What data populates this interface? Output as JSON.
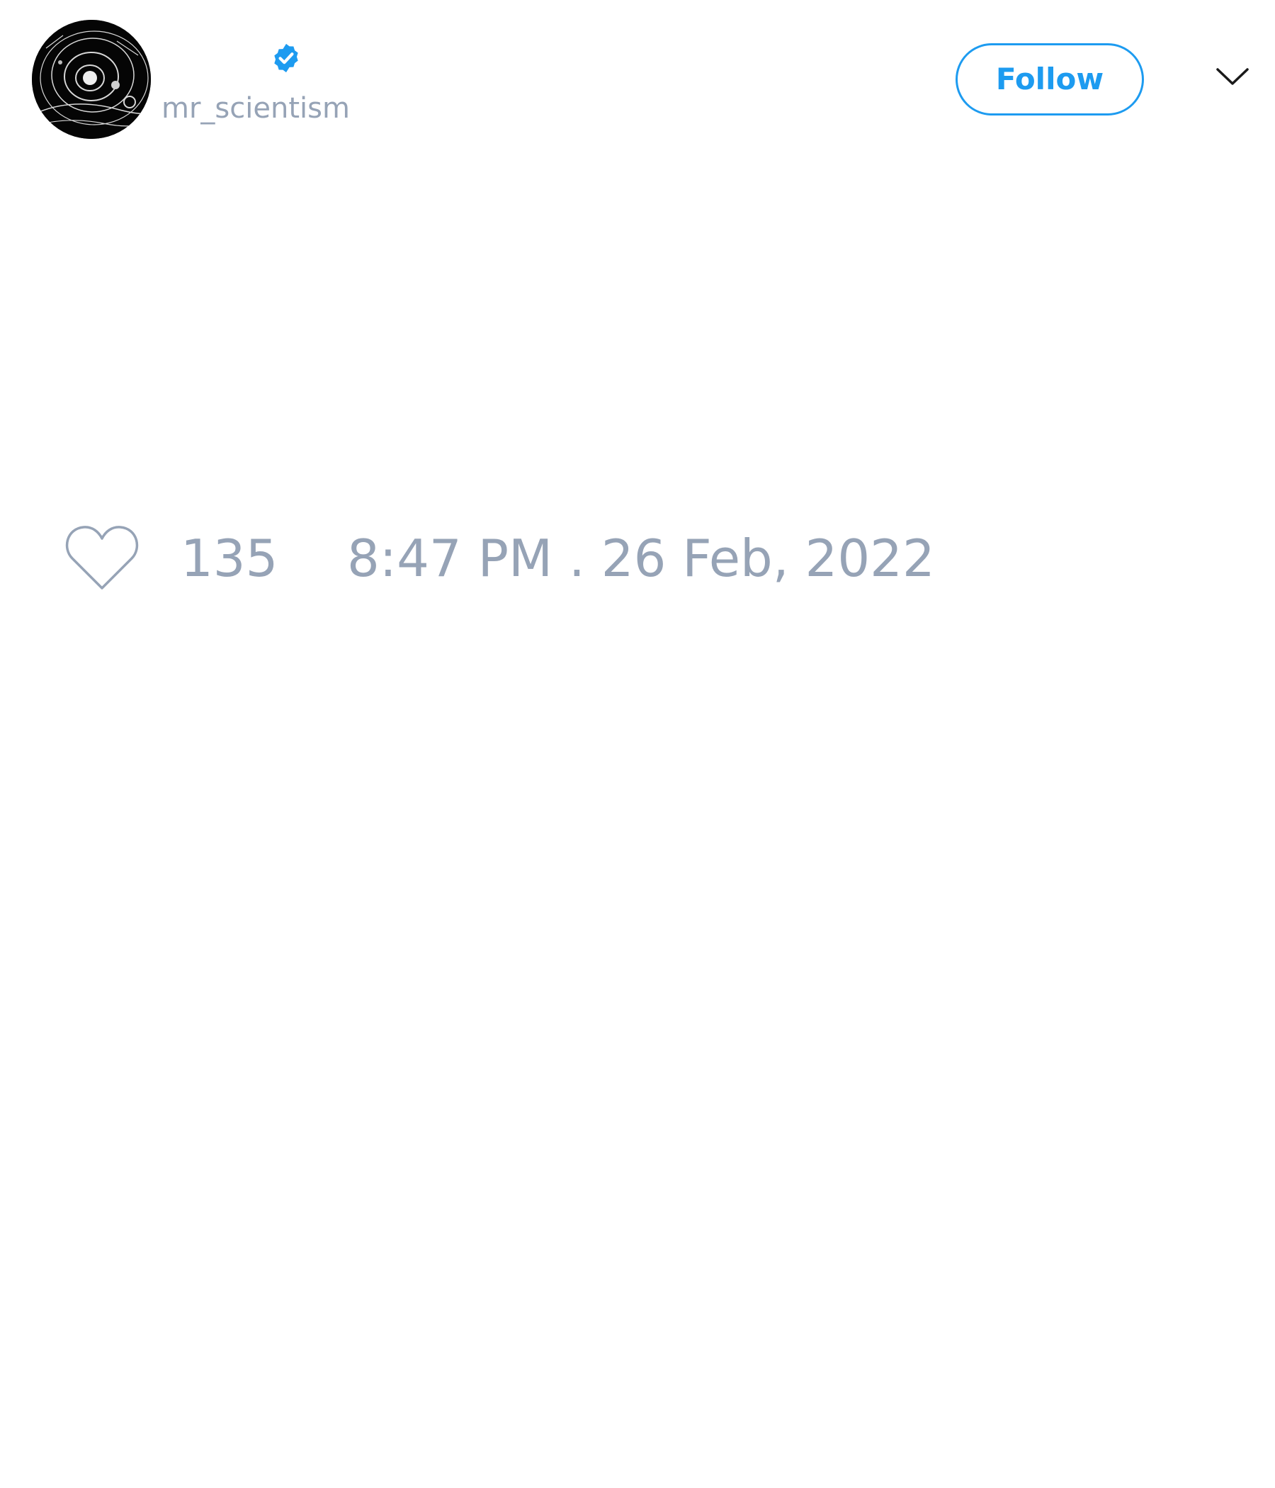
{
  "author": {
    "handle": "mr_scientism",
    "verified": true
  },
  "header": {
    "follow_label": "Follow"
  },
  "tweet": {
    "like_count": "135",
    "timestamp": "8:47 PM . 26 Feb, 2022"
  },
  "colors": {
    "accent": "#1d9bf0",
    "muted_text": "#96a3b6",
    "background": "#ffffff"
  },
  "icons": {
    "avatar": "solar-system-sketch-avatar",
    "verified": "verified-badge-icon",
    "menu": "chevron-down-icon",
    "like": "heart-outline-icon"
  }
}
